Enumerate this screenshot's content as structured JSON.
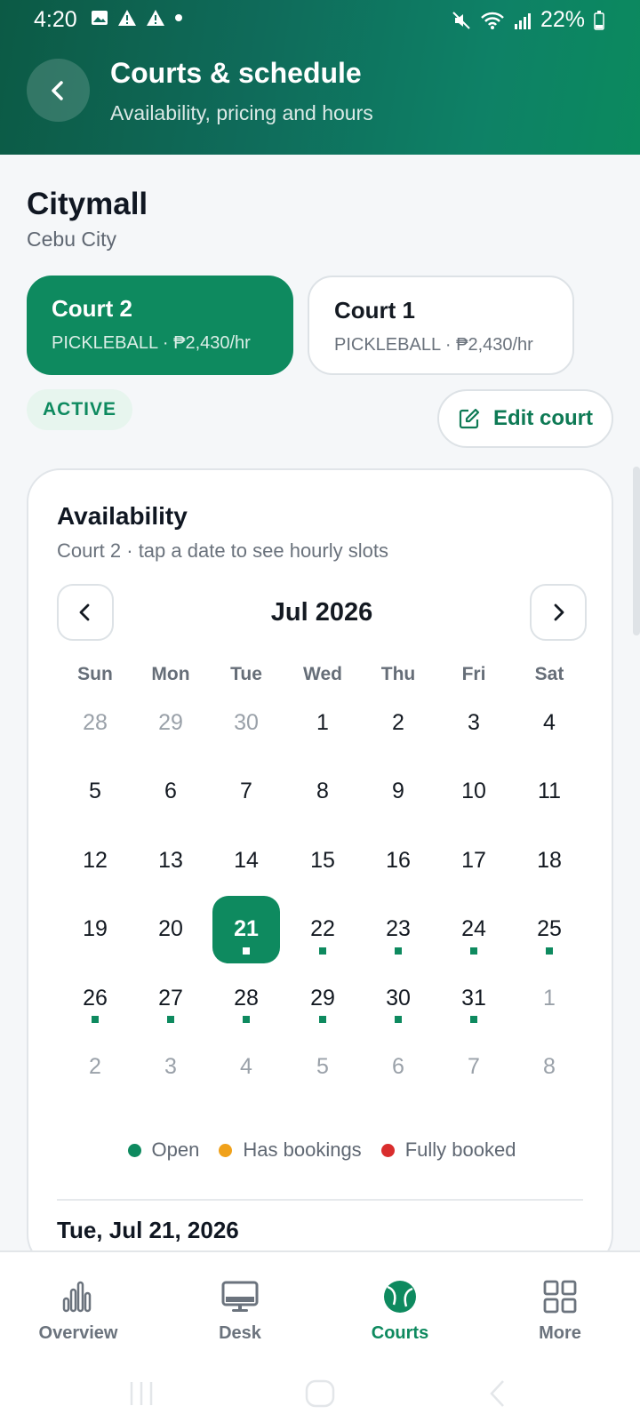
{
  "status_bar": {
    "time": "4:20",
    "battery": "22%"
  },
  "header": {
    "title": "Courts & schedule",
    "subtitle": "Availability, pricing and hours"
  },
  "venue": {
    "name": "Citymall",
    "city": "Cebu City"
  },
  "courts": [
    {
      "name": "Court 2",
      "meta": "PICKLEBALL · ₱2,430/hr",
      "selected": true
    },
    {
      "name": "Court 1",
      "meta": "PICKLEBALL · ₱2,430/hr",
      "selected": false
    }
  ],
  "status_badge": "ACTIVE",
  "edit_button": "Edit court",
  "availability": {
    "title": "Availability",
    "subtitle": "Court 2 · tap a date to see hourly slots",
    "month": "Jul 2026",
    "weekdays": [
      "Sun",
      "Mon",
      "Tue",
      "Wed",
      "Thu",
      "Fri",
      "Sat"
    ],
    "days": [
      {
        "d": "28",
        "m": true
      },
      {
        "d": "29",
        "m": true
      },
      {
        "d": "30",
        "m": true
      },
      {
        "d": "1"
      },
      {
        "d": "2"
      },
      {
        "d": "3"
      },
      {
        "d": "4"
      },
      {
        "d": "5"
      },
      {
        "d": "6"
      },
      {
        "d": "7"
      },
      {
        "d": "8"
      },
      {
        "d": "9"
      },
      {
        "d": "10"
      },
      {
        "d": "11"
      },
      {
        "d": "12"
      },
      {
        "d": "13"
      },
      {
        "d": "14"
      },
      {
        "d": "15"
      },
      {
        "d": "16"
      },
      {
        "d": "17"
      },
      {
        "d": "18"
      },
      {
        "d": "19"
      },
      {
        "d": "20"
      },
      {
        "d": "21",
        "sel": true,
        "open": true
      },
      {
        "d": "22",
        "open": true
      },
      {
        "d": "23",
        "open": true
      },
      {
        "d": "24",
        "open": true
      },
      {
        "d": "25",
        "open": true
      },
      {
        "d": "26",
        "open": true
      },
      {
        "d": "27",
        "open": true
      },
      {
        "d": "28",
        "open": true
      },
      {
        "d": "29",
        "open": true
      },
      {
        "d": "30",
        "open": true
      },
      {
        "d": "31",
        "open": true
      },
      {
        "d": "1",
        "m": true
      },
      {
        "d": "2",
        "m": true
      },
      {
        "d": "3",
        "m": true
      },
      {
        "d": "4",
        "m": true
      },
      {
        "d": "5",
        "m": true
      },
      {
        "d": "6",
        "m": true
      },
      {
        "d": "7",
        "m": true
      },
      {
        "d": "8",
        "m": true
      }
    ],
    "legend": [
      {
        "label": "Open",
        "color": "#0e8a5f"
      },
      {
        "label": "Has bookings",
        "color": "#f0a11a"
      },
      {
        "label": "Fully booked",
        "color": "#d92d2d"
      }
    ],
    "selected_date": "Tue, Jul 21, 2026"
  },
  "bottom_nav": [
    {
      "label": "Overview",
      "icon": "bar-chart-icon",
      "active": false
    },
    {
      "label": "Desk",
      "icon": "monitor-icon",
      "active": false
    },
    {
      "label": "Courts",
      "icon": "tennis-ball-icon",
      "active": true
    },
    {
      "label": "More",
      "icon": "grid-icon",
      "active": false
    }
  ]
}
